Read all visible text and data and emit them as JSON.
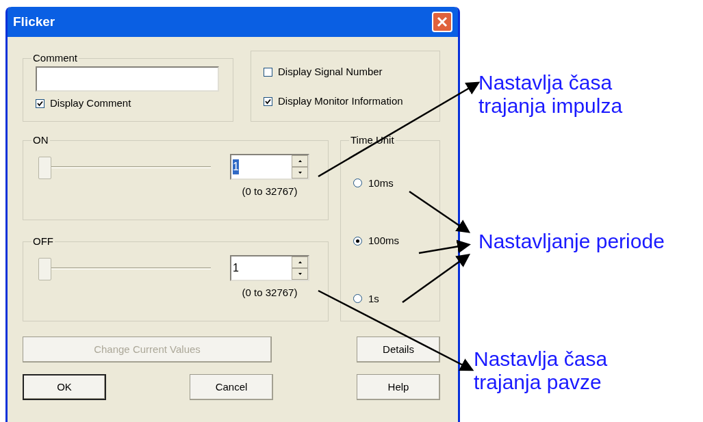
{
  "window": {
    "title": "Flicker"
  },
  "comment": {
    "legend": "Comment",
    "checkbox": {
      "label": "Display Comment",
      "checked": true
    }
  },
  "display_options": [
    {
      "label": "Display Signal Number",
      "checked": false
    },
    {
      "label": "Display Monitor Information",
      "checked": true
    }
  ],
  "settings": [
    {
      "legend": "ON",
      "slider": {
        "level": 0
      },
      "value": "1",
      "text_selected": true,
      "range": "(0 to 32767)"
    },
    {
      "legend": "OFF",
      "slider": {
        "level": 0
      },
      "value": "1",
      "text_selected": false,
      "range": "(0 to 32767)"
    }
  ],
  "time_unit": {
    "legend": "Time Unit",
    "options": [
      {
        "label": "10ms",
        "selected": false
      },
      {
        "label": "100ms",
        "selected": true
      },
      {
        "label": "1s",
        "selected": false
      }
    ]
  },
  "buttons": [
    {
      "label": "Change Current Values",
      "disabled": true,
      "default": false
    },
    {
      "label": "Details",
      "disabled": false,
      "default": false
    },
    {
      "label": "OK",
      "disabled": false,
      "default": true
    },
    {
      "label": "Cancel",
      "disabled": false,
      "default": false
    },
    {
      "label": "Help",
      "disabled": false,
      "default": false
    }
  ],
  "annotations": [
    {
      "lines": [
        "Nastavlja časa",
        "trajanja impulza"
      ]
    },
    {
      "lines": [
        "Nastavljanje periode"
      ]
    },
    {
      "lines": [
        "Nastavlja časa",
        "trajanja pavze"
      ]
    }
  ]
}
